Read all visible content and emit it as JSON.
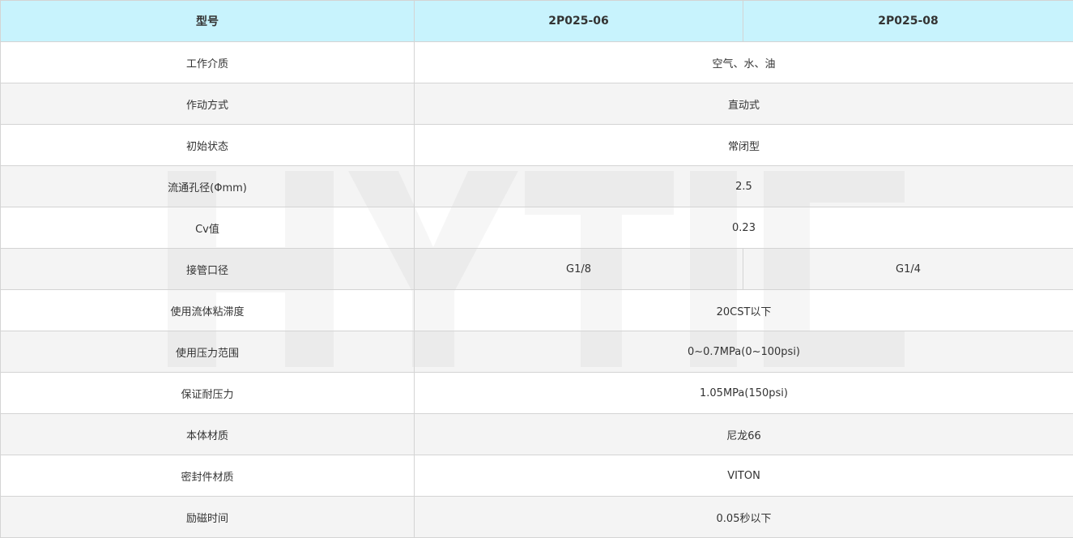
{
  "watermark": {
    "text": "HYTIC",
    "color": "#e2e2e2"
  },
  "colors": {
    "header_bg": "#c8f3fd",
    "row_alt_bg": "#f0f0f0",
    "border": "#d4d4d4"
  },
  "header": {
    "label": "型号",
    "models": [
      "2P025-06",
      "2P025-08"
    ]
  },
  "rows": [
    {
      "label": "工作介质",
      "value": "空气、水、油"
    },
    {
      "label": "作动方式",
      "value": "直动式"
    },
    {
      "label": "初始状态",
      "value": "常闭型"
    },
    {
      "label": "流通孔径(Φmm)",
      "value": "2.5"
    },
    {
      "label": "Cv值",
      "value": "0.23"
    },
    {
      "label": "接管口径",
      "values": [
        "G1/8",
        "G1/4"
      ]
    },
    {
      "label": "使用流体粘滞度",
      "value": "20CST以下"
    },
    {
      "label": "使用压力范围",
      "value": "0~0.7MPa(0~100psi)"
    },
    {
      "label": "保证耐压力",
      "value": "1.05MPa(150psi)"
    },
    {
      "label": "本体材质",
      "value": "尼龙66"
    },
    {
      "label": "密封件材质",
      "value": "VITON"
    },
    {
      "label": "励磁时间",
      "value": "0.05秒以下"
    }
  ]
}
